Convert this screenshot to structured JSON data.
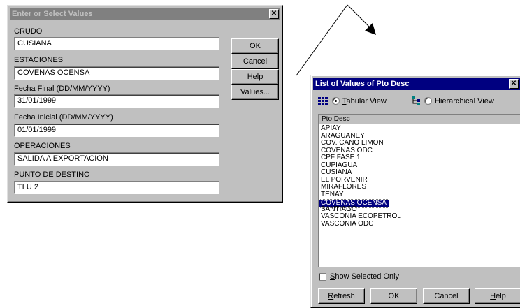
{
  "dialog1": {
    "title": "Enter or Select Values",
    "close_glyph": "✕",
    "fields": [
      {
        "label": "CRUDO",
        "value": "CUSIANA"
      },
      {
        "label": "ESTACIONES",
        "value": "COVENAS OCENSA"
      },
      {
        "label": "Fecha Final (DD/MM/YYYY)",
        "value": "31/01/1999"
      },
      {
        "label": "Fecha Inicial (DD/MM/YYYY)",
        "value": "01/01/1999"
      },
      {
        "label": "OPERACIONES",
        "value": "SALIDA A EXPORTACION"
      },
      {
        "label": "PUNTO DE DESTINO",
        "value": "TLU 2"
      }
    ],
    "buttons": {
      "ok": "OK",
      "cancel": "Cancel",
      "help": "Help",
      "values": "Values..."
    }
  },
  "dialog2": {
    "title": "List of Values of Pto Desc",
    "view_options": {
      "tabular": "Tabular View",
      "hierarchical": "Hierarchical View",
      "selected": "tabular"
    },
    "list_header": "Pto Desc",
    "items": [
      "APIAY",
      "ARAGUANEY",
      "COV. CANO LIMON",
      "COVENAS ODC",
      "CPF FASE 1",
      "CUPIAGUA",
      "CUSIANA",
      "EL PORVENIR",
      "MIRAFLORES",
      "TENAY",
      "COVENAS OCENSA",
      "SANTIAGO",
      "VASCONIA ECOPETROL",
      "VASCONIA ODC"
    ],
    "selected_item": "COVENAS OCENSA",
    "show_selected_only": {
      "label": "Show Selected Only",
      "checked": false
    },
    "buttons": {
      "refresh": "Refresh",
      "ok": "OK",
      "cancel": "Cancel",
      "help": "Help"
    }
  },
  "icons": {
    "grid": "grid-icon",
    "tree": "tree-icon",
    "arrow": "arrow-annotation"
  }
}
